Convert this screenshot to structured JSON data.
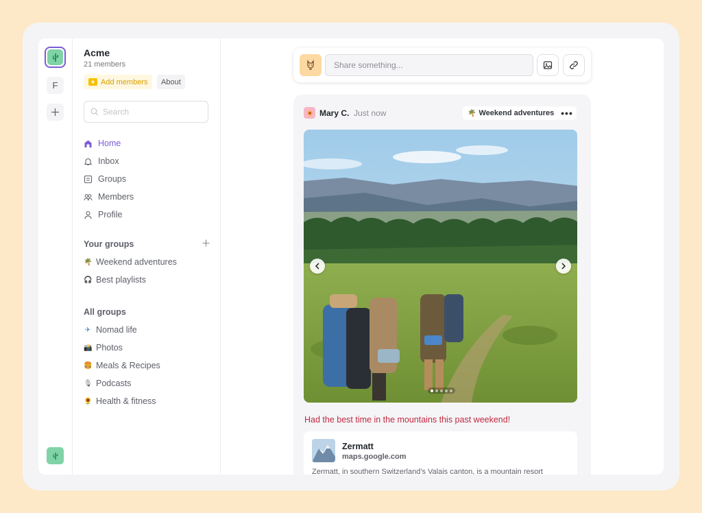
{
  "workspace": {
    "name": "Acme",
    "members": "21 members",
    "add_members_label": "Add members",
    "about_label": "About",
    "rail_letter": "F"
  },
  "search": {
    "placeholder": "Search"
  },
  "nav": [
    {
      "label": "Home",
      "icon": "home-icon",
      "active": true
    },
    {
      "label": "Inbox",
      "icon": "bell-icon"
    },
    {
      "label": "Groups",
      "icon": "groups-icon"
    },
    {
      "label": "Members",
      "icon": "members-icon"
    },
    {
      "label": "Profile",
      "icon": "profile-icon"
    }
  ],
  "your_groups": {
    "title": "Your groups",
    "items": [
      {
        "label": "Weekend adventures",
        "icon": "palm-tree-icon",
        "emoji": "🌴"
      },
      {
        "label": "Best playlists",
        "icon": "headphones-icon",
        "emoji": "🎧"
      }
    ]
  },
  "all_groups": {
    "title": "All groups",
    "items": [
      {
        "label": "Nomad life",
        "icon": "airplane-icon",
        "emoji": "✈"
      },
      {
        "label": "Photos",
        "icon": "camera-icon",
        "emoji": "📸"
      },
      {
        "label": "Meals & Recipes",
        "icon": "food-icon",
        "emoji": "🍔"
      },
      {
        "label": "Podcasts",
        "icon": "microphone-icon",
        "emoji": "🎙"
      },
      {
        "label": "Health & fitness",
        "icon": "sun-icon",
        "emoji": "🌻"
      }
    ]
  },
  "composer": {
    "placeholder": "Share something..."
  },
  "post": {
    "author": "Mary C.",
    "time": "Just now",
    "group_tag": "Weekend adventures",
    "more_label": "•••",
    "caption": "Had the best time in the mountains this past weekend!",
    "carousel": {
      "count": 5,
      "current": 1
    },
    "link": {
      "title": "Zermatt",
      "url": "maps.google.com",
      "description": "Zermatt, in southern Switzerland's Valais canton, is a mountain resort"
    }
  },
  "colors": {
    "accent": "#7c5cd6",
    "caption": "#c0283f",
    "add_members": "#d9a000",
    "background": "#fde9c8"
  }
}
